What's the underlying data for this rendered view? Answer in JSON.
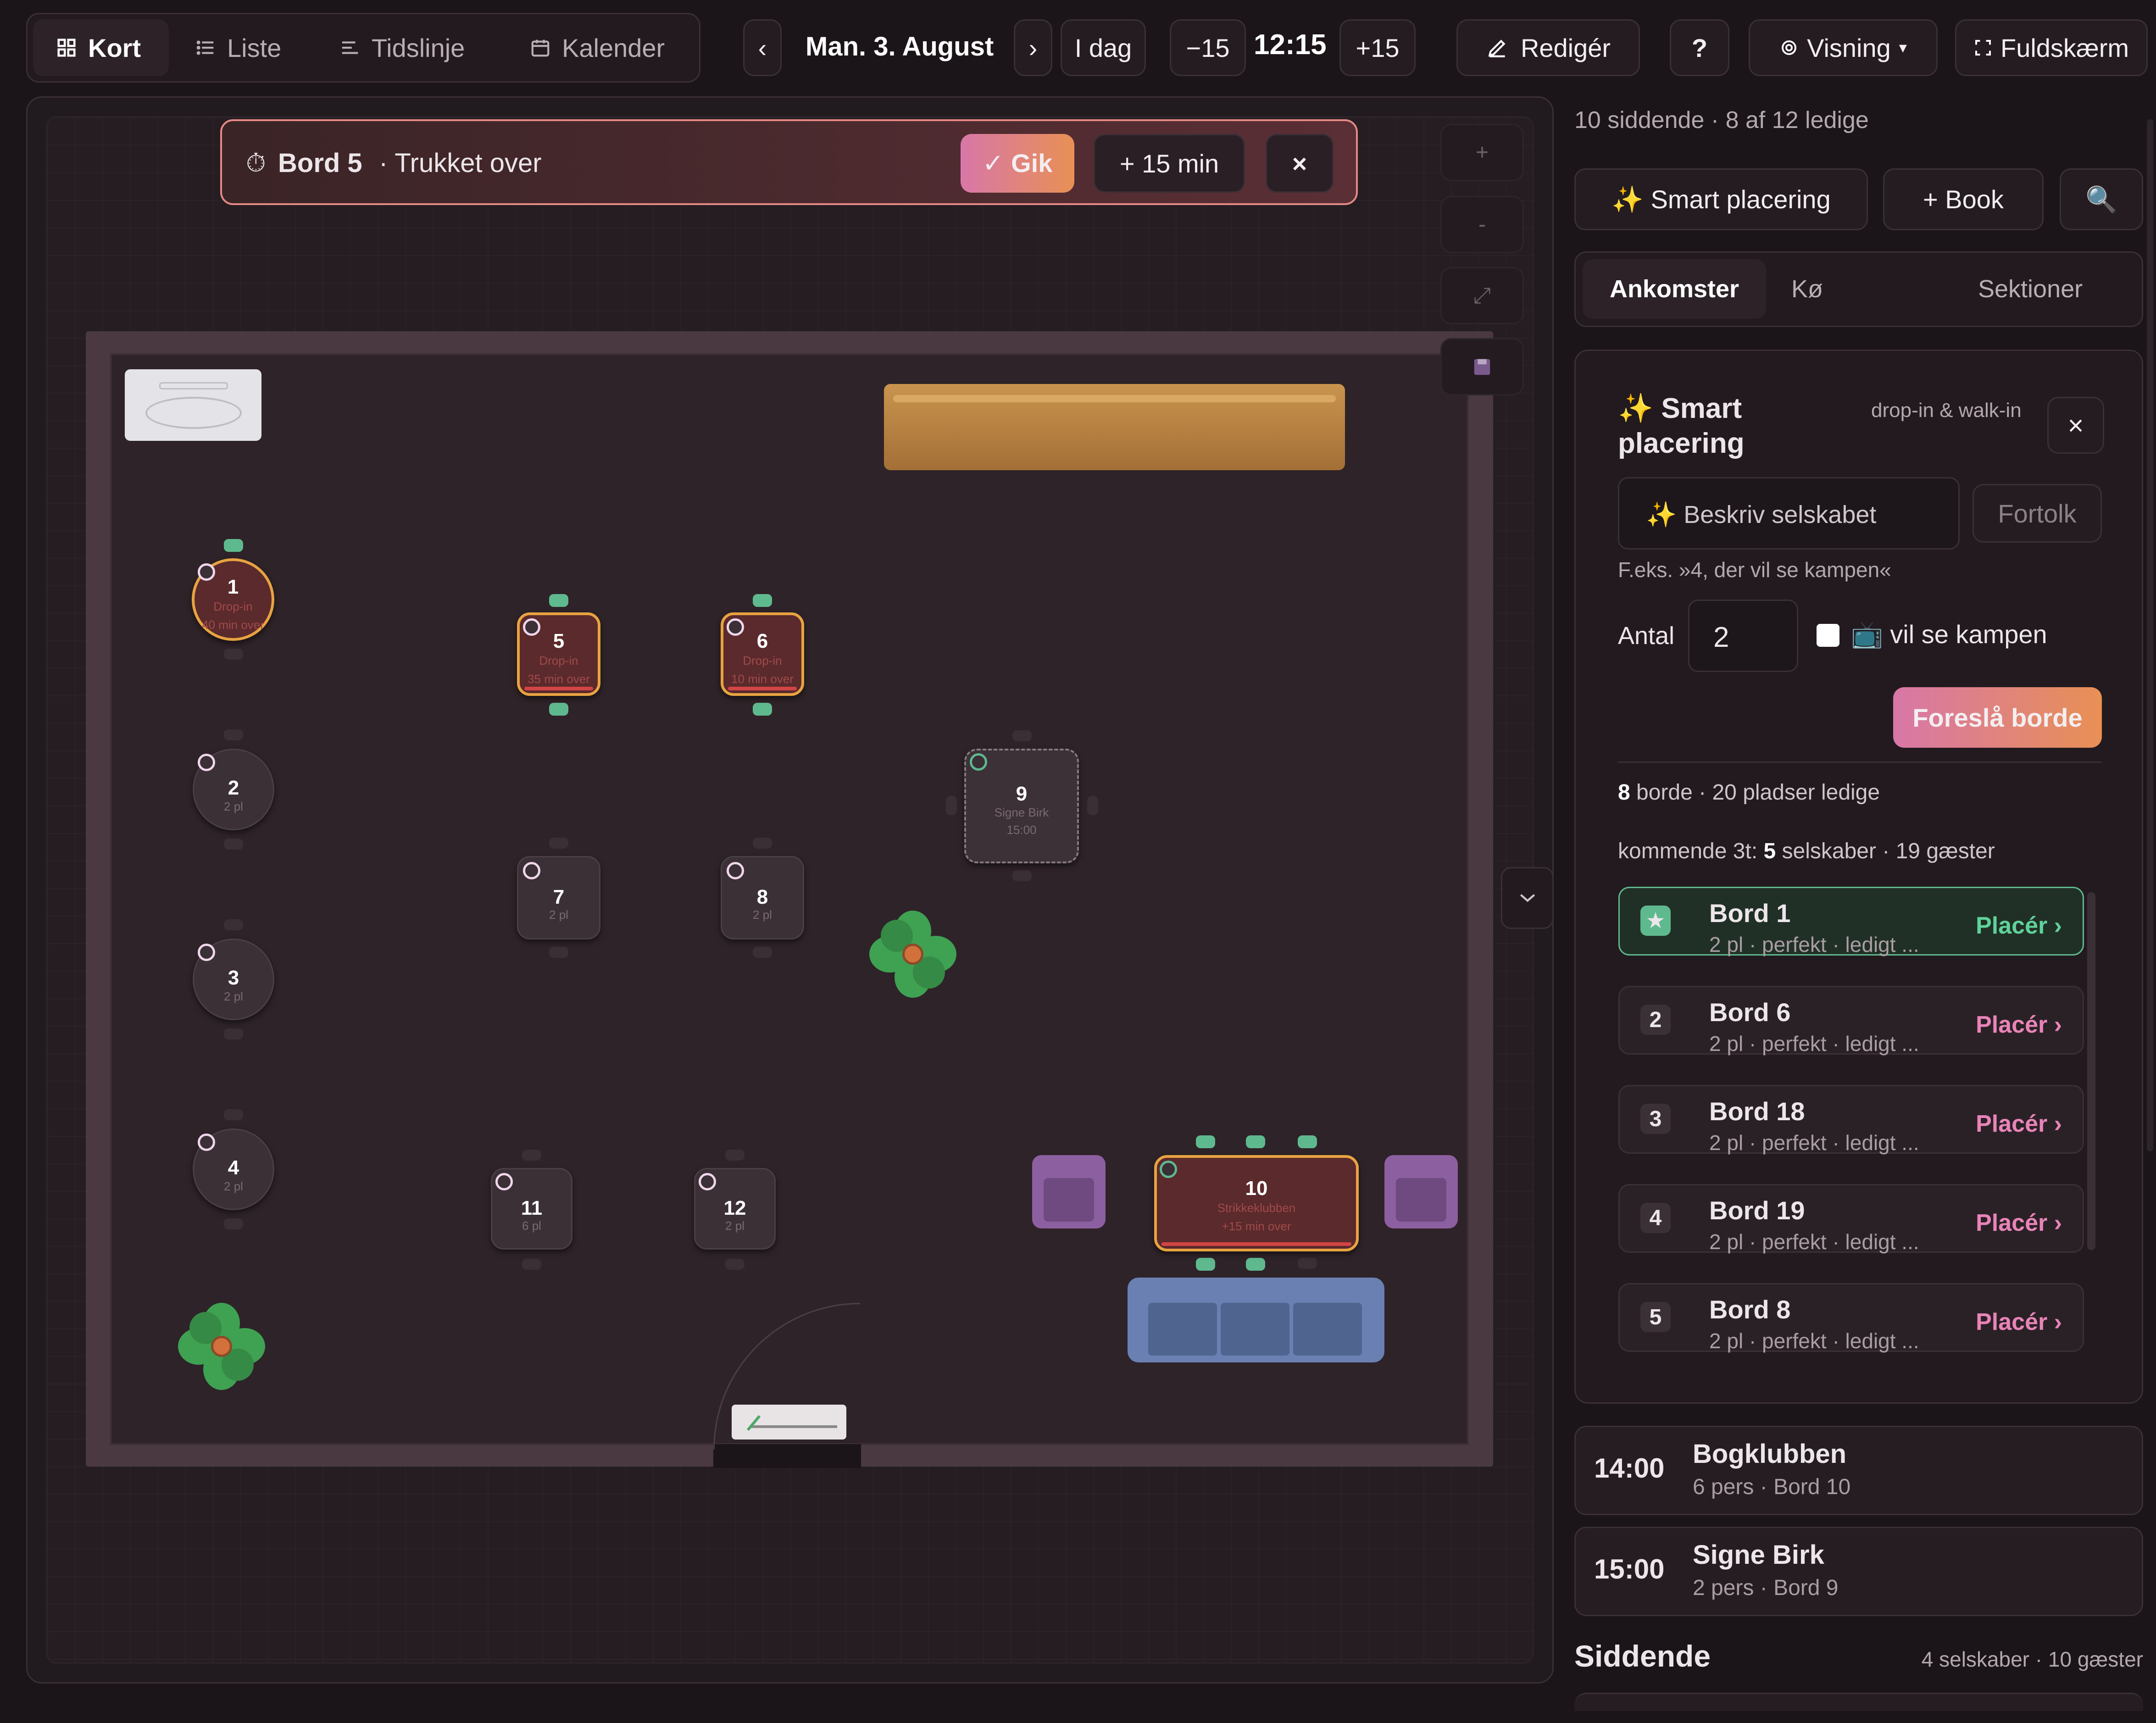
{
  "top_nav": {
    "views": [
      {
        "label": "Kort",
        "icon": "grid-icon"
      },
      {
        "label": "Liste",
        "icon": "list-icon"
      },
      {
        "label": "Tidslinje",
        "icon": "timeline-icon"
      },
      {
        "label": "Kalender",
        "icon": "calendar-icon"
      }
    ],
    "prev": "‹",
    "date": "Man. 3. August",
    "next": "›",
    "today": "I dag",
    "minus": "−15",
    "time": "12:15",
    "plus": "+15",
    "edit": "Redigér",
    "help": "?",
    "view": "Visning",
    "view_caret": "▾",
    "fullscreen": "Fuldskærm"
  },
  "alert": {
    "icon": "⏱",
    "table": "Bord 5",
    "message": "· Trukket over",
    "done": "✓ Gik",
    "extend": "+ 15 min",
    "close": "×"
  },
  "map_controls": {
    "zoom_in": "+",
    "zoom_out": "-",
    "fit": "⤢"
  },
  "tables": {
    "t1": {
      "num": "1",
      "sub1": "Drop-in",
      "sub2": "40 min over"
    },
    "t2": {
      "num": "2",
      "sub1": "2 pl"
    },
    "t3": {
      "num": "3",
      "sub1": "2 pl"
    },
    "t4": {
      "num": "4",
      "sub1": "2 pl"
    },
    "t5": {
      "num": "5",
      "sub1": "Drop-in",
      "sub2": "35 min over"
    },
    "t6": {
      "num": "6",
      "sub1": "Drop-in",
      "sub2": "10 min over"
    },
    "t7": {
      "num": "7",
      "sub1": "2 pl"
    },
    "t8": {
      "num": "8",
      "sub1": "2 pl"
    },
    "t9": {
      "num": "9",
      "sub1": "Signe Birk",
      "sub2": "15:00"
    },
    "t10": {
      "num": "10",
      "sub1": "Strikkeklubben",
      "sub2": "+15 min over"
    },
    "t11": {
      "num": "11",
      "sub1": "6 pl"
    },
    "t12": {
      "num": "12",
      "sub1": "2 pl"
    }
  },
  "sidebar": {
    "stats": "10 siddende · 8 af 12 ledige",
    "smart_btn": "✨ Smart placering",
    "book_btn": "+ Book",
    "search_icon": "🔍",
    "tabs": [
      "Ankomster",
      "Kø",
      "Sektioner"
    ],
    "smart": {
      "title": "✨ Smart placering",
      "subtitle": "drop-in & walk-in",
      "close": "×",
      "input_placeholder": "✨ Beskriv selskabet",
      "interpret": "Fortolk",
      "hint": "F.eks. »4, der vil se kampen«",
      "count_label": "Antal",
      "count_value": "2",
      "match_label": "📺 vil se kampen",
      "suggest": "Foreslå borde",
      "summary_bold": "8",
      "summary": " borde · 20 pladser ledige",
      "upcoming_prefix": "kommende 3t: ",
      "upcoming_bold": "5",
      "upcoming_suffix": " selskaber · 19 gæster",
      "suggestions": [
        {
          "rank": "★",
          "name": "Bord 1",
          "desc": "2 pl · perfekt · ledigt ...",
          "action": "Placér ›"
        },
        {
          "rank": "2",
          "name": "Bord 6",
          "desc": "2 pl · perfekt · ledigt ...",
          "action": "Placér ›"
        },
        {
          "rank": "3",
          "name": "Bord 18",
          "desc": "2 pl · perfekt · ledigt ...",
          "action": "Placér ›"
        },
        {
          "rank": "4",
          "name": "Bord 19",
          "desc": "2 pl · perfekt · ledigt ...",
          "action": "Placér ›"
        },
        {
          "rank": "5",
          "name": "Bord 8",
          "desc": "2 pl · perfekt · ledigt ...",
          "action": "Placér ›"
        }
      ]
    },
    "arrivals": [
      {
        "time": "14:00",
        "name": "Bogklubben",
        "details": "6 pers · Bord 10"
      },
      {
        "time": "15:00",
        "name": "Signe Birk",
        "details": "2 pers · Bord 9"
      }
    ],
    "seated_title": "Siddende",
    "seated_summary": "4 selskaber · 10 gæster"
  },
  "colors": {
    "accent": "#e884b8",
    "accent2": "#e9924a",
    "success": "#5fb98f",
    "warning": "#e8a341"
  }
}
